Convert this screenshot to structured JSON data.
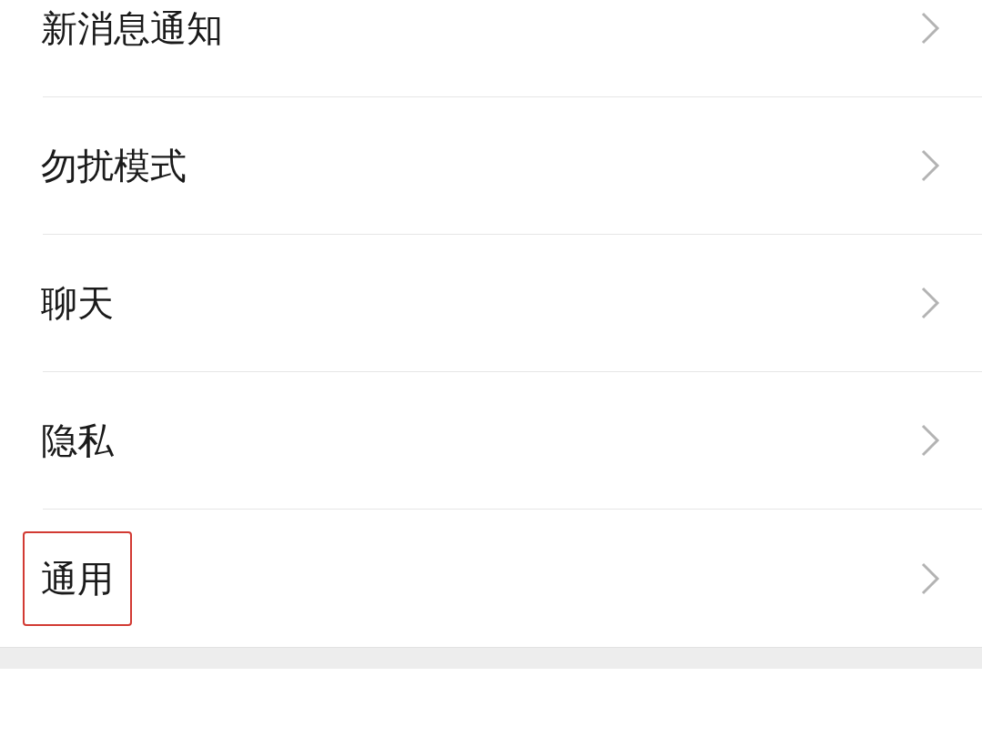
{
  "groups": [
    {
      "items": [
        {
          "label": "新消息通知",
          "highlighted": false
        },
        {
          "label": "勿扰模式",
          "highlighted": false
        },
        {
          "label": "聊天",
          "highlighted": false
        },
        {
          "label": "隐私",
          "highlighted": false
        },
        {
          "label": "通用",
          "highlighted": true
        }
      ]
    }
  ]
}
